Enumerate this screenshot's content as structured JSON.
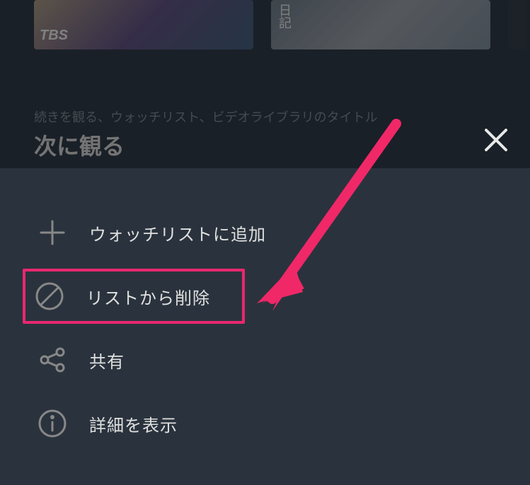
{
  "section": {
    "subtitle": "続きを観る、ウォッチリスト、ビデオライブラリのタイトル",
    "title": "次に観る"
  },
  "thumbnails": {
    "tbs_badge": "TBS",
    "nikki": "日記"
  },
  "menu": {
    "add_watchlist": "ウォッチリストに追加",
    "remove_list": "リストから削除",
    "share": "共有",
    "show_details": "詳細を表示"
  },
  "annotation": {
    "arrow_color": "#f02868",
    "highlight_color": "#e82870"
  }
}
